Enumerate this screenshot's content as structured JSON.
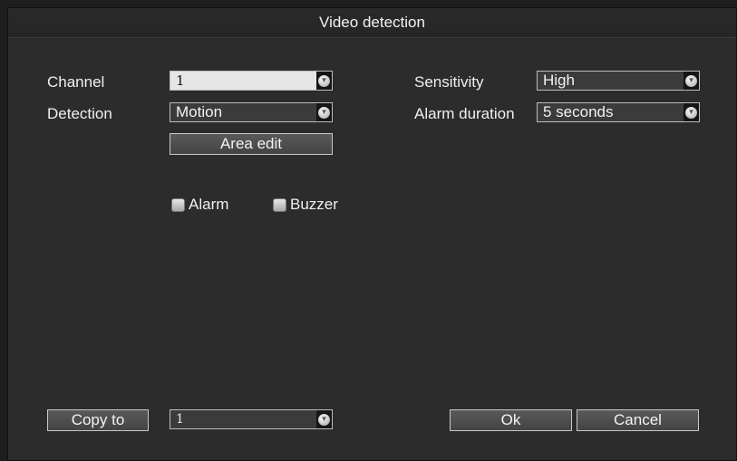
{
  "window": {
    "title": "Video detection"
  },
  "form": {
    "channel": {
      "label": "Channel",
      "value": "1"
    },
    "detection": {
      "label": "Detection",
      "value": "Motion"
    },
    "area_edit_label": "Area edit",
    "sensitivity": {
      "label": "Sensitivity",
      "value": "High"
    },
    "alarm_duration": {
      "label": "Alarm duration",
      "value": "5 seconds"
    },
    "alarm_checkbox": {
      "label": "Alarm",
      "checked": false
    },
    "buzzer_checkbox": {
      "label": "Buzzer",
      "checked": false
    }
  },
  "footer": {
    "copy_to_label": "Copy to",
    "copy_to_value": "1",
    "ok_label": "Ok",
    "cancel_label": "Cancel"
  }
}
